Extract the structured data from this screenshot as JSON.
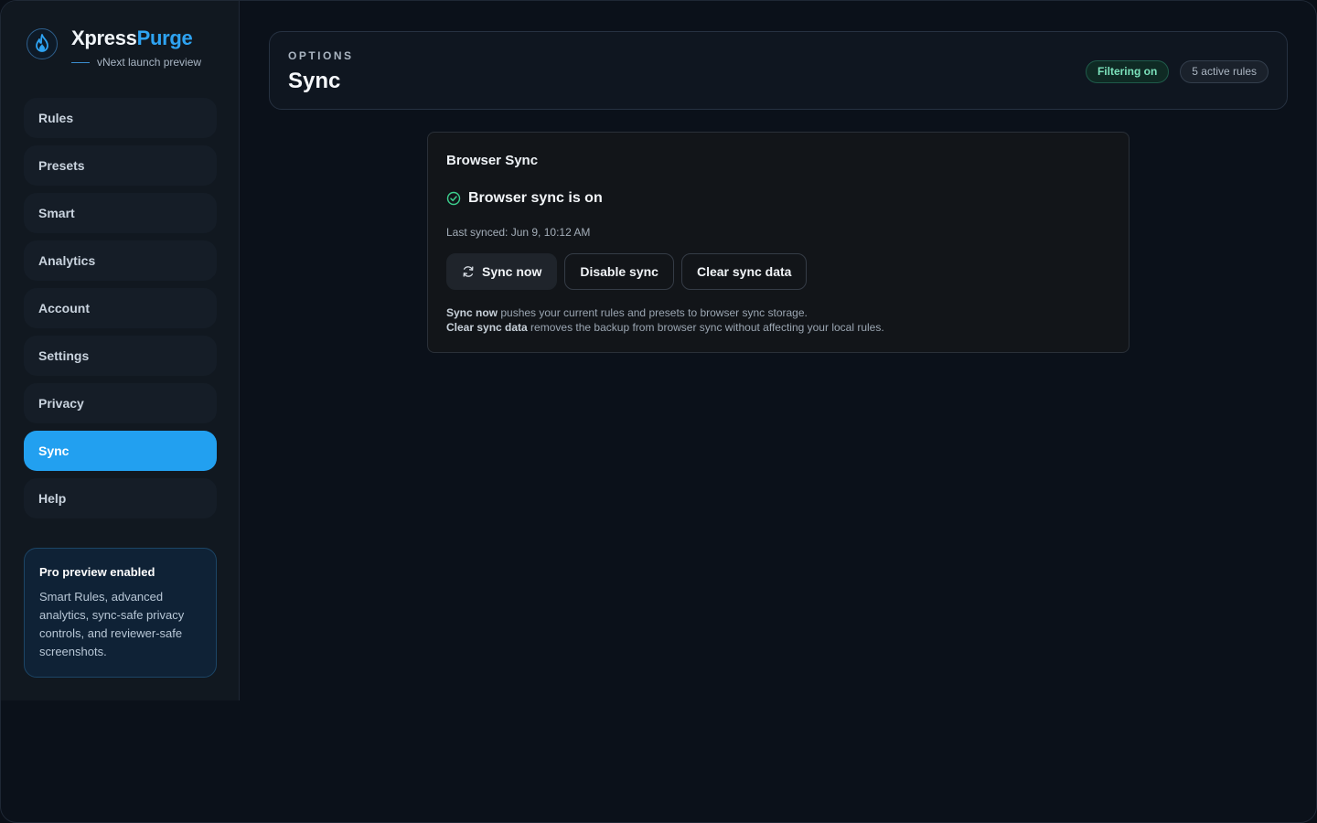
{
  "brand": {
    "name_part1": "Xpress",
    "name_part2": "Purge",
    "subtitle": "vNext launch preview",
    "logo_icon": "flame-icon"
  },
  "sidebar": {
    "items": [
      {
        "label": "Rules",
        "active": false
      },
      {
        "label": "Presets",
        "active": false
      },
      {
        "label": "Smart",
        "active": false
      },
      {
        "label": "Analytics",
        "active": false
      },
      {
        "label": "Account",
        "active": false
      },
      {
        "label": "Settings",
        "active": false
      },
      {
        "label": "Privacy",
        "active": false
      },
      {
        "label": "Sync",
        "active": true
      },
      {
        "label": "Help",
        "active": false
      }
    ],
    "promo": {
      "title": "Pro preview enabled",
      "body": "Smart Rules, advanced analytics, sync-safe privacy controls, and reviewer-safe screenshots."
    }
  },
  "header": {
    "eyebrow": "OPTIONS",
    "title": "Sync",
    "badges": {
      "filtering": "Filtering on",
      "rules": "5 active rules"
    }
  },
  "sync_card": {
    "title": "Browser Sync",
    "status_text": "Browser sync is on",
    "status_icon": "check-circle-icon",
    "last_synced": "Last synced: Jun 9, 10:12 AM",
    "buttons": {
      "sync_now": "Sync now",
      "disable": "Disable sync",
      "clear": "Clear sync data"
    },
    "notes": {
      "line1_bold": "Sync now",
      "line1_rest": " pushes your current rules and presets to browser sync storage.",
      "line2_bold": "Clear sync data",
      "line2_rest": " removes the backup from browser sync without affecting your local rules."
    }
  },
  "colors": {
    "accent": "#22a0f0",
    "success": "#3ccf8e",
    "background": "#0b111a"
  }
}
